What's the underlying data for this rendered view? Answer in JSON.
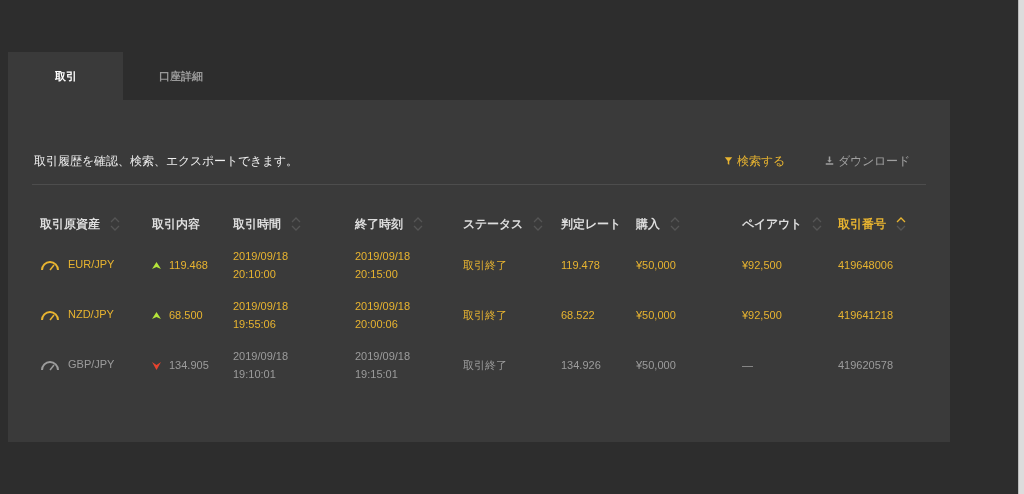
{
  "tabs": [
    {
      "label": "取引",
      "selected": true
    },
    {
      "label": "口座詳細",
      "selected": false
    }
  ],
  "description": "取引履歴を確認、検索、エクスポートできます。",
  "actions": [
    {
      "kind": "filter",
      "label": "検索する",
      "disabled": false
    },
    {
      "kind": "download",
      "label": "ダウンロード",
      "disabled": true
    }
  ],
  "table": {
    "columns": [
      {
        "label": "取引原資産",
        "sortable": true,
        "sorted": false
      },
      {
        "label": "取引内容",
        "sortable": false,
        "sorted": false
      },
      {
        "label": "取引時間",
        "sortable": true,
        "sorted": false
      },
      {
        "label": "終了時刻",
        "sortable": true,
        "sorted": false
      },
      {
        "label": "ステータス",
        "sortable": true,
        "sorted": false
      },
      {
        "label": "判定レート",
        "sortable": false,
        "sorted": false
      },
      {
        "label": "購入",
        "sortable": true,
        "sorted": false
      },
      {
        "label": "ペイアウト",
        "sortable": true,
        "sorted": false
      },
      {
        "label": "取引番号",
        "sortable": true,
        "sorted": true
      }
    ],
    "rows": [
      {
        "won": true,
        "rising": true,
        "asset": "EUR/JPY",
        "rate": "119.468",
        "start": [
          "2019/09/18",
          "20:10:00"
        ],
        "end": [
          "2019/09/18",
          "20:15:00"
        ],
        "status": "取引終了",
        "judge_rate": "119.478",
        "purchase": "¥50,000",
        "payout": "¥92,500",
        "number": "419648006"
      },
      {
        "won": true,
        "rising": true,
        "asset": "NZD/JPY",
        "rate": "68.500",
        "start": [
          "2019/09/18",
          "19:55:06"
        ],
        "end": [
          "2019/09/18",
          "20:00:06"
        ],
        "status": "取引終了",
        "judge_rate": "68.522",
        "purchase": "¥50,000",
        "payout": "¥92,500",
        "number": "419641218"
      },
      {
        "won": false,
        "rising": false,
        "asset": "GBP/JPY",
        "rate": "134.905",
        "start": [
          "2019/09/18",
          "19:10:01"
        ],
        "end": [
          "2019/09/18",
          "19:15:01"
        ],
        "status": "取引終了",
        "judge_rate": "134.926",
        "purchase": "¥50,000",
        "payout": "—",
        "number": "419620578"
      }
    ]
  }
}
